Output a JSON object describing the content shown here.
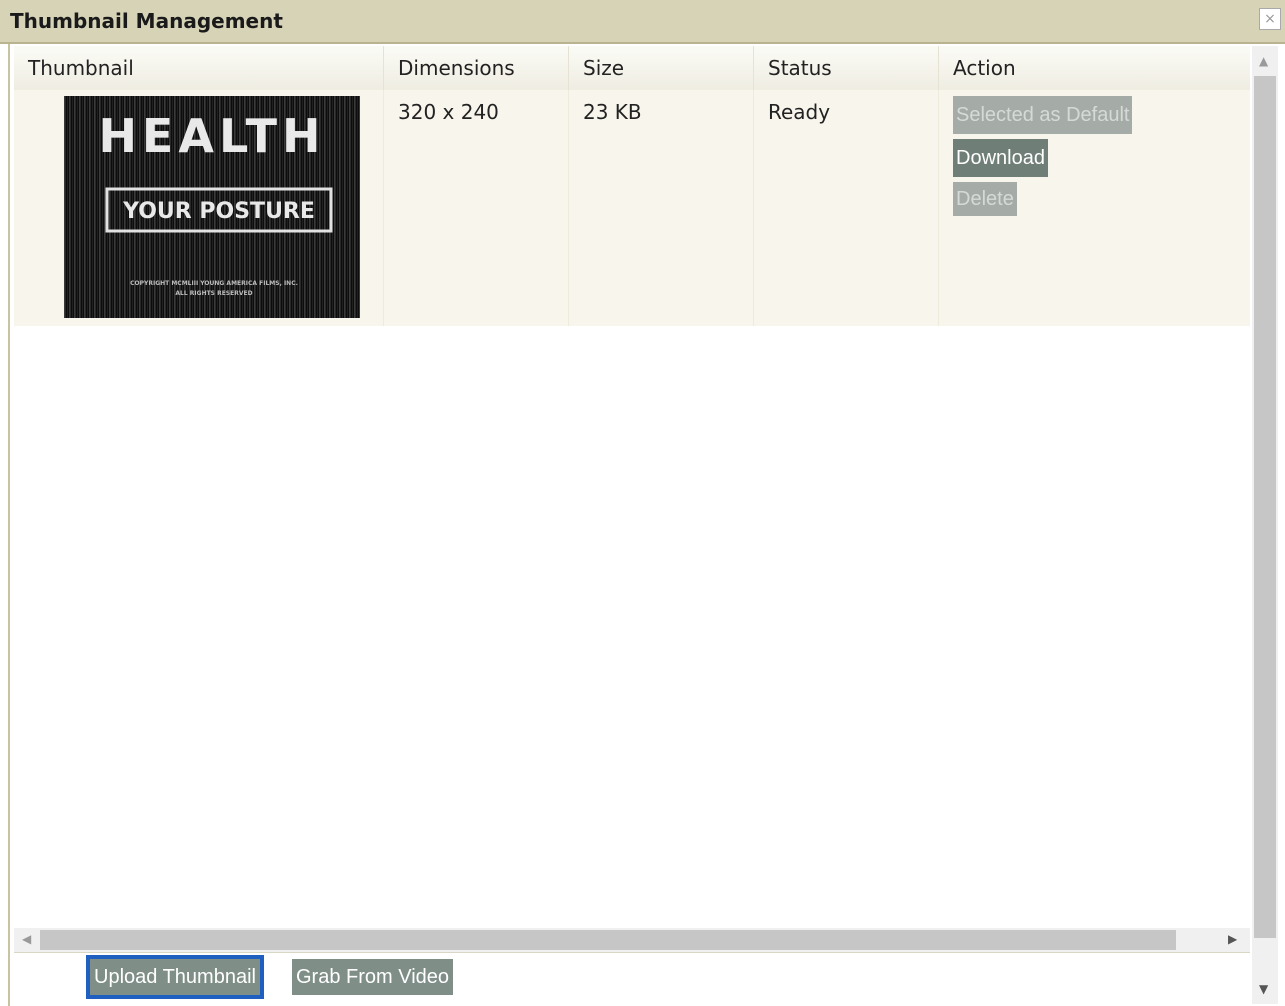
{
  "window": {
    "title": "Thumbnail Management",
    "close_glyph": "×"
  },
  "table": {
    "headers": {
      "thumbnail": "Thumbnail",
      "dimensions": "Dimensions",
      "size": "Size",
      "status": "Status",
      "action": "Action"
    },
    "rows": [
      {
        "thumbnail": {
          "title": "HEALTH",
          "subtitle": "YOUR POSTURE",
          "copyright_line1": "COPYRIGHT MCMLIII YOUNG AMERICA FILMS, INC.",
          "copyright_line2": "ALL RIGHTS RESERVED"
        },
        "dimensions": "320 x 240",
        "size": "23 KB",
        "status": "Ready",
        "actions": {
          "selected_default": "Selected as Default",
          "download": "Download",
          "delete": "Delete"
        }
      }
    ]
  },
  "footer": {
    "upload": "Upload Thumbnail",
    "grab": "Grab From Video"
  },
  "colors": {
    "title_bar": "#d6d3b7",
    "row_background": "#f8f5ec",
    "button_active": "#6f7f78",
    "button_disabled": "#a5aca8",
    "focus_ring": "#1e5fbf"
  }
}
